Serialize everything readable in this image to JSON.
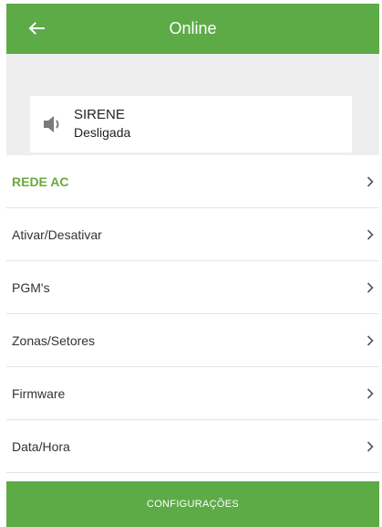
{
  "header": {
    "title": "Online",
    "back_icon": "arrow-left-icon"
  },
  "status": {
    "icon": "speaker-icon",
    "label": "SIRENE",
    "value": "Desligada"
  },
  "menu": {
    "items": [
      {
        "label": "REDE AC",
        "highlight": true
      },
      {
        "label": "Ativar/Desativar"
      },
      {
        "label": "PGM's"
      },
      {
        "label": "Zonas/Setores"
      },
      {
        "label": "Firmware"
      },
      {
        "label": "Data/Hora"
      }
    ],
    "chevron_icon": "chevron-right-icon"
  },
  "footer": {
    "button_label": "CONFIGURAÇÕES"
  },
  "colors": {
    "accent": "#5cab47",
    "highlight_text": "#6aa83f",
    "background_gray": "#eeeeee"
  }
}
